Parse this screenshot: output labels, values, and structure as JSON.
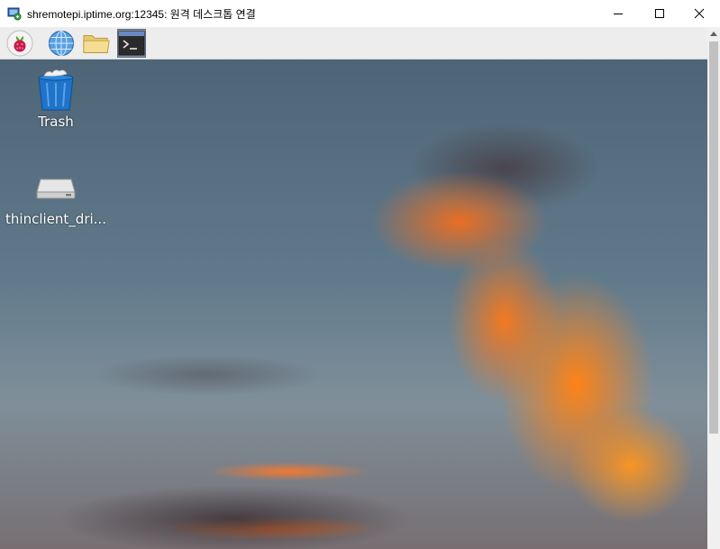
{
  "window": {
    "title": "shremotepi.iptime.org:12345: 원격 데스크톱 연결",
    "buttons": [
      "minimize",
      "maximize",
      "close"
    ]
  },
  "panel": {
    "launchers": [
      {
        "name": "raspberry-menu",
        "icon": "raspberry-pi-icon"
      },
      {
        "name": "web-browser",
        "icon": "globe-icon"
      },
      {
        "name": "file-manager",
        "icon": "folder-icon"
      },
      {
        "name": "terminal",
        "icon": "terminal-icon",
        "active": true
      }
    ]
  },
  "desktop": {
    "icons": [
      {
        "label": "Trash",
        "icon": "trash-icon"
      },
      {
        "label": "thinclient_dri...",
        "icon": "drive-icon"
      }
    ]
  },
  "colors": {
    "panel_bg": "#ededed",
    "active_launcher": "#7f8ea3",
    "trash_blue": "#1f73c8"
  }
}
